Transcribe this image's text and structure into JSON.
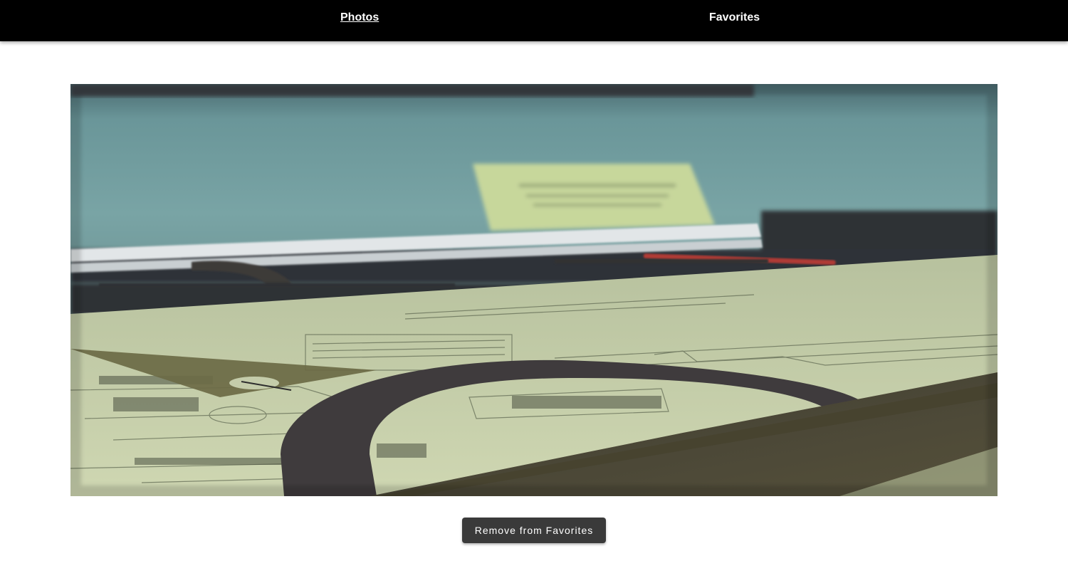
{
  "nav": {
    "items": [
      {
        "label": "Photos",
        "active": true
      },
      {
        "label": "Favorites",
        "active": false
      }
    ]
  },
  "photo": {
    "description_icon": "photo-image",
    "colors": {
      "wall": "#6f9a9c",
      "paper": "#c9d3ac",
      "protractor": "#3e3b3c",
      "ruler": "#4b4736",
      "triangle": "#6b6a45"
    }
  },
  "actions": {
    "remove_label": "Remove from Favorites"
  },
  "colors": {
    "topbar": "#000000",
    "button": "#3a3a3a",
    "background": "#ffffff"
  }
}
